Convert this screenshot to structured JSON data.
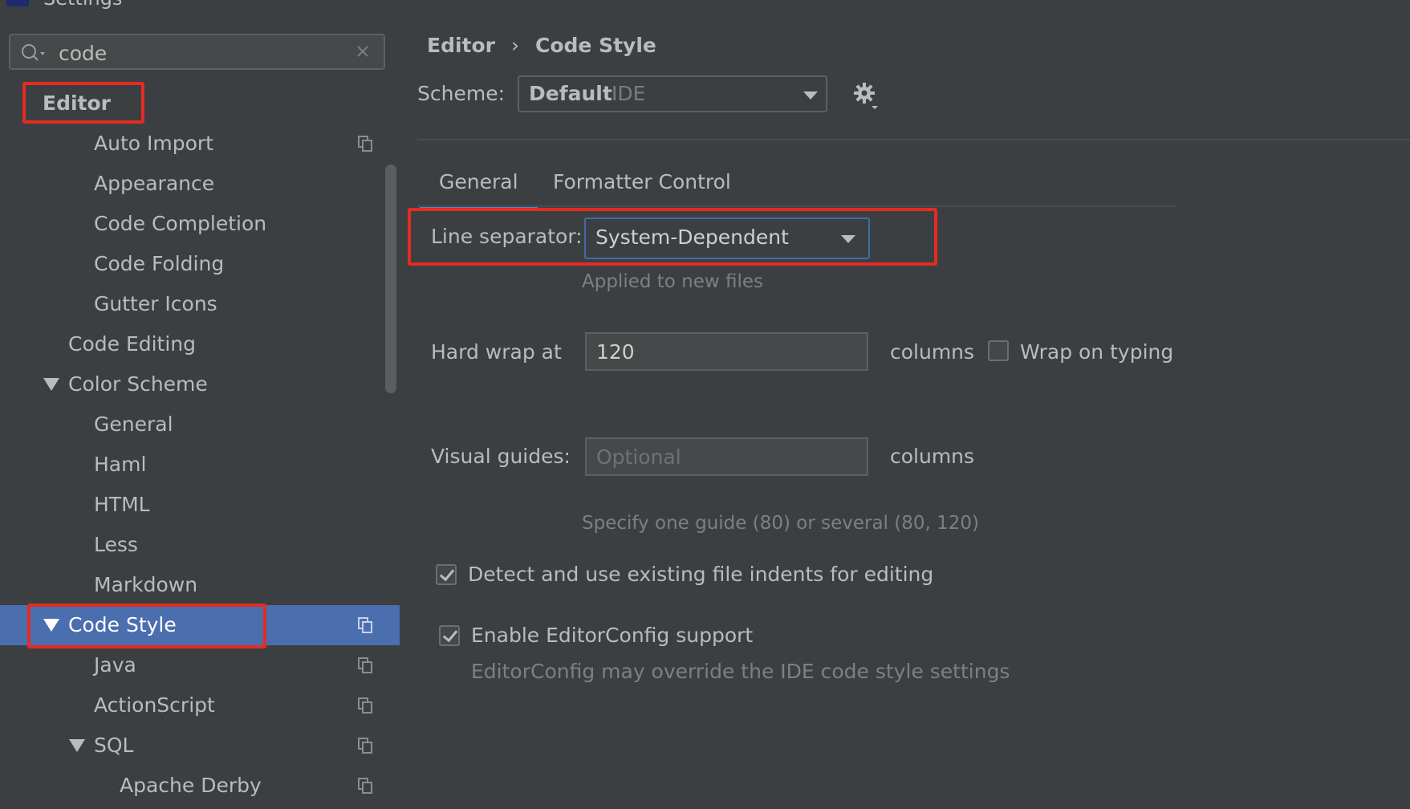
{
  "window": {
    "title": "Settings"
  },
  "sidebar": {
    "search": {
      "value": "code"
    },
    "items": [
      {
        "label": "Editor"
      },
      {
        "label": "Auto Import"
      },
      {
        "label": "Appearance"
      },
      {
        "label": "Code Completion"
      },
      {
        "label": "Code Folding"
      },
      {
        "label": "Gutter Icons"
      },
      {
        "label": "Code Editing"
      },
      {
        "label": "Color Scheme"
      },
      {
        "label": "General"
      },
      {
        "label": "Haml"
      },
      {
        "label": "HTML"
      },
      {
        "label": "Less"
      },
      {
        "label": "Markdown"
      },
      {
        "label": "Code Style"
      },
      {
        "label": "Java"
      },
      {
        "label": "ActionScript"
      },
      {
        "label": "SQL"
      },
      {
        "label": "Apache Derby"
      }
    ]
  },
  "main": {
    "breadcrumb": {
      "parent": "Editor",
      "separator": "›",
      "current": "Code Style"
    },
    "scheme": {
      "label": "Scheme:",
      "value": "Default",
      "scope": "IDE"
    },
    "tabs": [
      {
        "label": "General"
      },
      {
        "label": "Formatter Control"
      }
    ],
    "line_separator": {
      "label": "Line separator:",
      "value": "System-Dependent",
      "hint": "Applied to new files"
    },
    "hard_wrap": {
      "label": "Hard wrap at",
      "value": "120",
      "unit": "columns",
      "wrap_on_typing": "Wrap on typing"
    },
    "visual_guides": {
      "label": "Visual guides:",
      "placeholder": "Optional",
      "unit": "columns",
      "hint": "Specify one guide (80) or several (80, 120)"
    },
    "detect_indents": {
      "label": "Detect and use existing file indents for editing",
      "checked": true
    },
    "editorconfig": {
      "label": "Enable EditorConfig support",
      "checked": true,
      "hint": "EditorConfig may override the IDE code style settings"
    }
  },
  "colors": {
    "selection": "#4b6eaf",
    "highlight_box": "#e52b22",
    "tab_underline": "#4a88c7"
  }
}
